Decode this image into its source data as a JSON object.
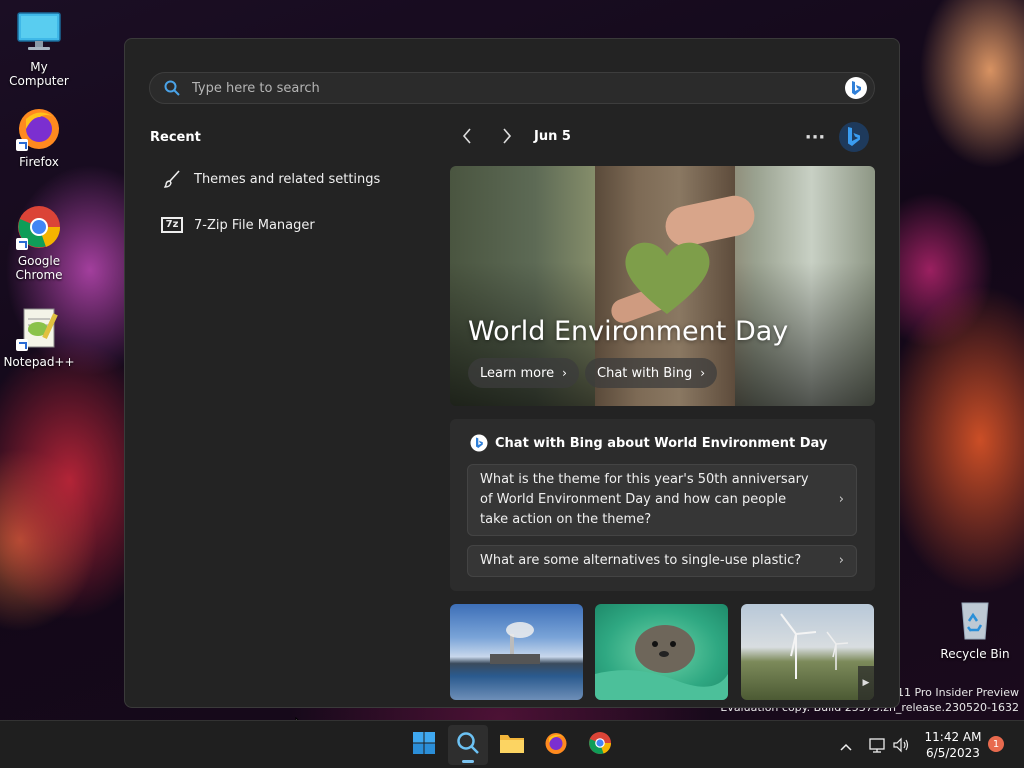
{
  "desktop": {
    "icons": [
      {
        "label": "My Computer"
      },
      {
        "label": "Firefox"
      },
      {
        "label": "Google Chrome"
      },
      {
        "label": "Notepad++"
      },
      {
        "label": "Recycle Bin"
      }
    ],
    "watermark_line1": "s 11 Pro Insider Preview",
    "watermark_line2": "Evaluation copy. Build 25375.zn_release.230520-1632"
  },
  "search": {
    "placeholder": "Type here to search"
  },
  "recent": {
    "title": "Recent",
    "items": [
      {
        "label": "Themes and related settings",
        "icon": "paintbrush-icon"
      },
      {
        "label": "7-Zip File Manager",
        "icon": "7zip-icon",
        "icon_text": "7z"
      }
    ]
  },
  "feed": {
    "date": "Jun 5",
    "more_label": "···",
    "hero": {
      "title": "World Environment Day",
      "learn_more": "Learn more",
      "chat_with_bing": "Chat with Bing"
    },
    "chat": {
      "heading": "Chat with Bing about World Environment Day",
      "questions": [
        "What is the theme for this year's 50th anniversary of World Environment Day and how can people take action on the theme?",
        "What are some alternatives to single-use plastic?"
      ]
    }
  },
  "taskbar": {
    "clock_time": "11:42 AM",
    "clock_date": "6/5/2023",
    "notification_count": "1"
  },
  "colors": {
    "panel_bg": "#232323",
    "accent": "#2f7fd8",
    "badge": "#e86a4e"
  }
}
